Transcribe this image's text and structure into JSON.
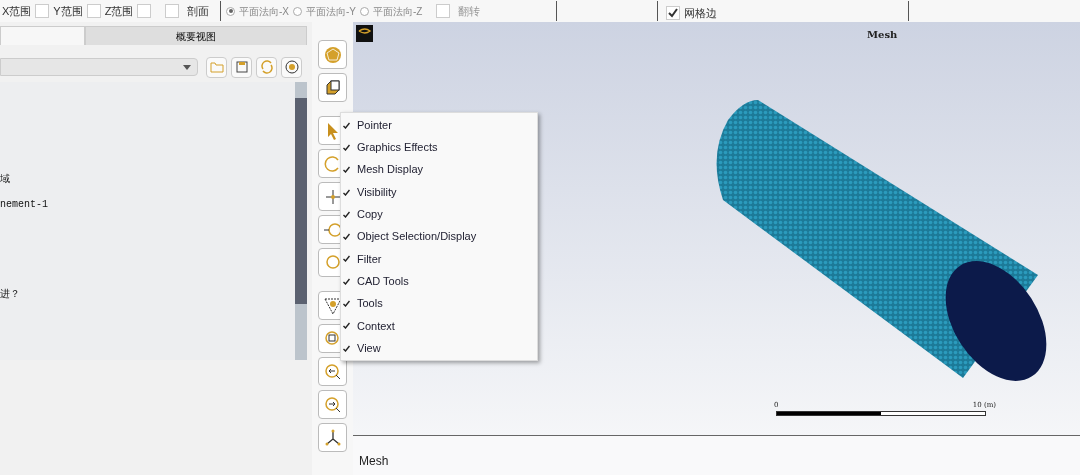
{
  "toolbar": {
    "range_checks": [
      {
        "label": "X范围",
        "checked": false
      },
      {
        "label": "Y范围",
        "checked": false
      },
      {
        "label": "Z范围",
        "checked": false
      }
    ],
    "section": {
      "label": "剖面",
      "checked": false
    },
    "normals": [
      {
        "label": "平面法向-X",
        "selected": true
      },
      {
        "label": "平面法向-Y",
        "selected": false
      },
      {
        "label": "平面法向-Z",
        "selected": false
      }
    ],
    "flip": {
      "label": "翻转",
      "checked": false
    },
    "mesh_edges": {
      "label": "网格边",
      "checked": true
    }
  },
  "left_panel": {
    "tabs": [
      {
        "selected": true
      },
      {
        "label": "概要视图",
        "selected": false
      }
    ],
    "tree_lines": [
      "域",
      "nement-1",
      "进？"
    ]
  },
  "viewport": {
    "title": "Mesh",
    "scale_start": "0",
    "scale_end": "10 (m)"
  },
  "context_menu": [
    {
      "label": "Pointer",
      "checked": true
    },
    {
      "label": "Graphics Effects",
      "checked": true
    },
    {
      "label": "Mesh Display",
      "checked": true
    },
    {
      "label": "Visibility",
      "checked": true
    },
    {
      "label": "Copy",
      "checked": true
    },
    {
      "label": "Object Selection/Display",
      "checked": true
    },
    {
      "label": "Filter",
      "checked": true
    },
    {
      "label": "CAD Tools",
      "checked": true
    },
    {
      "label": "Tools",
      "checked": true
    },
    {
      "label": "Context",
      "checked": true
    },
    {
      "label": "View",
      "checked": true
    }
  ],
  "console": {
    "text": "Mesh"
  }
}
